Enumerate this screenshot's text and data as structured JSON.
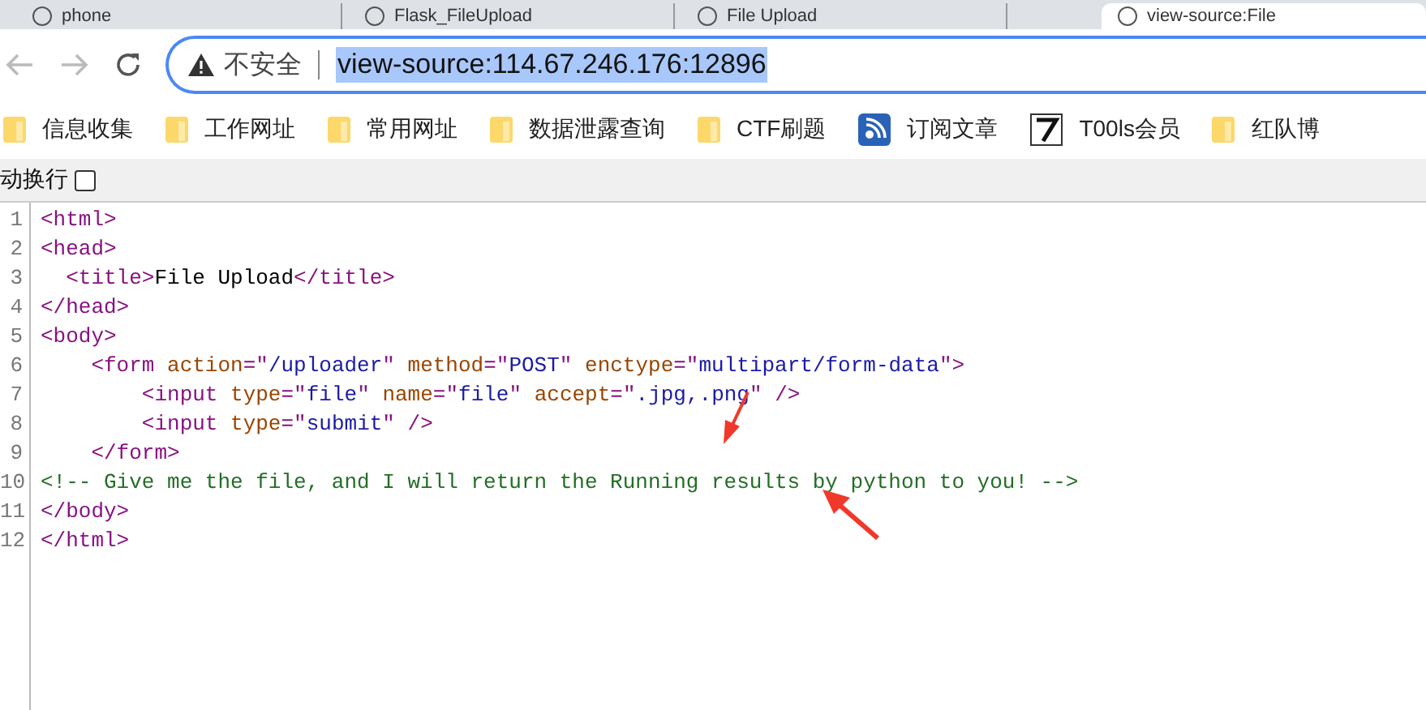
{
  "tabs": [
    {
      "title": "phone",
      "selected": false
    },
    {
      "title": "Flask_FileUpload",
      "selected": false
    },
    {
      "title": "File Upload",
      "selected": false
    },
    {
      "title": "view-source:File",
      "selected": true
    }
  ],
  "address_bar": {
    "security": "不安全",
    "url": "view-source:114.67.246.176:12896"
  },
  "bookmarks": [
    {
      "label": "信息收集",
      "kind": "folder"
    },
    {
      "label": "工作网址",
      "kind": "folder"
    },
    {
      "label": "常用网址",
      "kind": "folder"
    },
    {
      "label": "数据泄露查询",
      "kind": "folder"
    },
    {
      "label": "CTF刷题",
      "kind": "folder"
    },
    {
      "label": "订阅文章",
      "kind": "feed"
    },
    {
      "label": "T00ls会员",
      "kind": "seven"
    },
    {
      "label": "红队博",
      "kind": "folder"
    }
  ],
  "wrap_toggle": {
    "label": "动换行",
    "checked": false
  },
  "source_lines": [
    {
      "number": "1",
      "tokens": [
        {
          "kind": "tag",
          "text": "<html>"
        }
      ]
    },
    {
      "number": "2",
      "tokens": [
        {
          "kind": "tag",
          "text": "<head>"
        }
      ]
    },
    {
      "number": "3",
      "tokens": [
        {
          "kind": "tag",
          "text": "  <title>"
        },
        {
          "kind": "text",
          "text": "File Upload"
        },
        {
          "kind": "tag",
          "text": "</title>"
        }
      ]
    },
    {
      "number": "4",
      "tokens": [
        {
          "kind": "tag",
          "text": "</head>"
        }
      ]
    },
    {
      "number": "5",
      "tokens": [
        {
          "kind": "tag",
          "text": "<body>"
        }
      ]
    },
    {
      "number": "6",
      "tokens": [
        {
          "kind": "tag",
          "text": "    <form "
        },
        {
          "kind": "attr",
          "text": "action"
        },
        {
          "kind": "tag",
          "text": "=\""
        },
        {
          "kind": "value",
          "text": "/uploader"
        },
        {
          "kind": "tag",
          "text": "\" "
        },
        {
          "kind": "attr",
          "text": "method"
        },
        {
          "kind": "tag",
          "text": "=\""
        },
        {
          "kind": "value",
          "text": "POST"
        },
        {
          "kind": "tag",
          "text": "\" "
        },
        {
          "kind": "attr",
          "text": "enctype"
        },
        {
          "kind": "tag",
          "text": "=\""
        },
        {
          "kind": "value",
          "text": "multipart/form-data"
        },
        {
          "kind": "tag",
          "text": "\">"
        }
      ]
    },
    {
      "number": "7",
      "tokens": [
        {
          "kind": "tag",
          "text": "        <input "
        },
        {
          "kind": "attr",
          "text": "type"
        },
        {
          "kind": "tag",
          "text": "=\""
        },
        {
          "kind": "value",
          "text": "file"
        },
        {
          "kind": "tag",
          "text": "\" "
        },
        {
          "kind": "attr",
          "text": "name"
        },
        {
          "kind": "tag",
          "text": "=\""
        },
        {
          "kind": "value",
          "text": "file"
        },
        {
          "kind": "tag",
          "text": "\" "
        },
        {
          "kind": "attr",
          "text": "accept"
        },
        {
          "kind": "tag",
          "text": "=\""
        },
        {
          "kind": "value",
          "text": ".jpg,.png"
        },
        {
          "kind": "tag",
          "text": "\" />"
        }
      ]
    },
    {
      "number": "8",
      "tokens": [
        {
          "kind": "tag",
          "text": "        <input "
        },
        {
          "kind": "attr",
          "text": "type"
        },
        {
          "kind": "tag",
          "text": "=\""
        },
        {
          "kind": "value",
          "text": "submit"
        },
        {
          "kind": "tag",
          "text": "\" />"
        }
      ]
    },
    {
      "number": "9",
      "tokens": [
        {
          "kind": "tag",
          "text": "    </form>"
        }
      ]
    },
    {
      "number": "10",
      "tokens": [
        {
          "kind": "comment",
          "text": "<!-- Give me the file, and I will return the Running results by python to you! -->"
        }
      ]
    },
    {
      "number": "11",
      "tokens": [
        {
          "kind": "tag",
          "text": "</body>"
        }
      ]
    },
    {
      "number": "12",
      "tokens": [
        {
          "kind": "tag",
          "text": "</html>"
        }
      ]
    }
  ],
  "annotations": [
    {
      "kind": "arrow-down-left"
    },
    {
      "kind": "arrow-up-left"
    }
  ]
}
